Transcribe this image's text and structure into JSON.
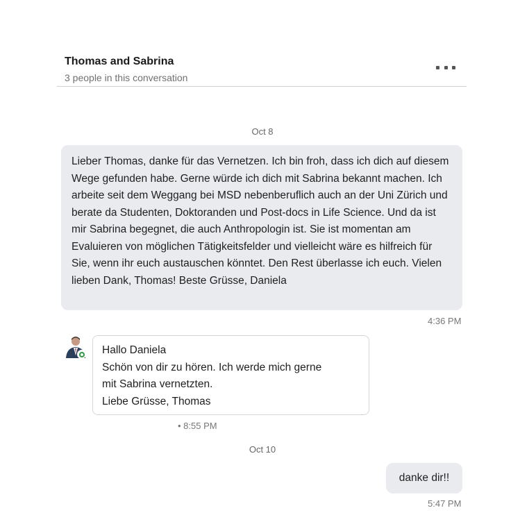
{
  "conversation": {
    "title": "Thomas and Sabrina",
    "subtitle": "3 people in this conversation"
  },
  "messages": {
    "date_1": "Oct 8",
    "msg1": {
      "text": "Lieber Thomas, danke für das Vernetzen. Ich bin froh, dass ich dich auf diesem Wege gefunden habe. Gerne würde ich dich mit Sabrina bekannt machen. Ich arbeite seit dem Weggang bei MSD nebenberuflich auch an der Uni Zürich und berate da Studenten, Doktoranden und Post-docs in Life Science. Und da ist mir Sabrina begegnet, die auch Anthropologin ist. Sie ist momentan am Evaluieren von möglichen Tätigkeitsfelder und vielleicht wäre es hilfreich für Sie, wenn ihr euch austauschen könntet. Den Rest überlasse ich euch. Vielen lieben Dank, Thomas! Beste Grüsse, Daniela",
      "time": "4:36 PM"
    },
    "msg2": {
      "line1": "Hallo Daniela",
      "line2": "Schön von dir zu hören. Ich werde mich gerne",
      "line3": "mit Sabrina vernetzten.",
      "line4": "Liebe Grüsse, Thomas",
      "time": "• 8:55 PM"
    },
    "date_2": "Oct 10",
    "msg3": {
      "text": "danke dir!!",
      "time": "5:47 PM"
    }
  },
  "icons": {
    "more": "more-options-icon",
    "avatar": "avatar",
    "status": "online-status-icon"
  },
  "colors": {
    "bubble": "#e9ebef",
    "online": "#2e9a3f"
  }
}
